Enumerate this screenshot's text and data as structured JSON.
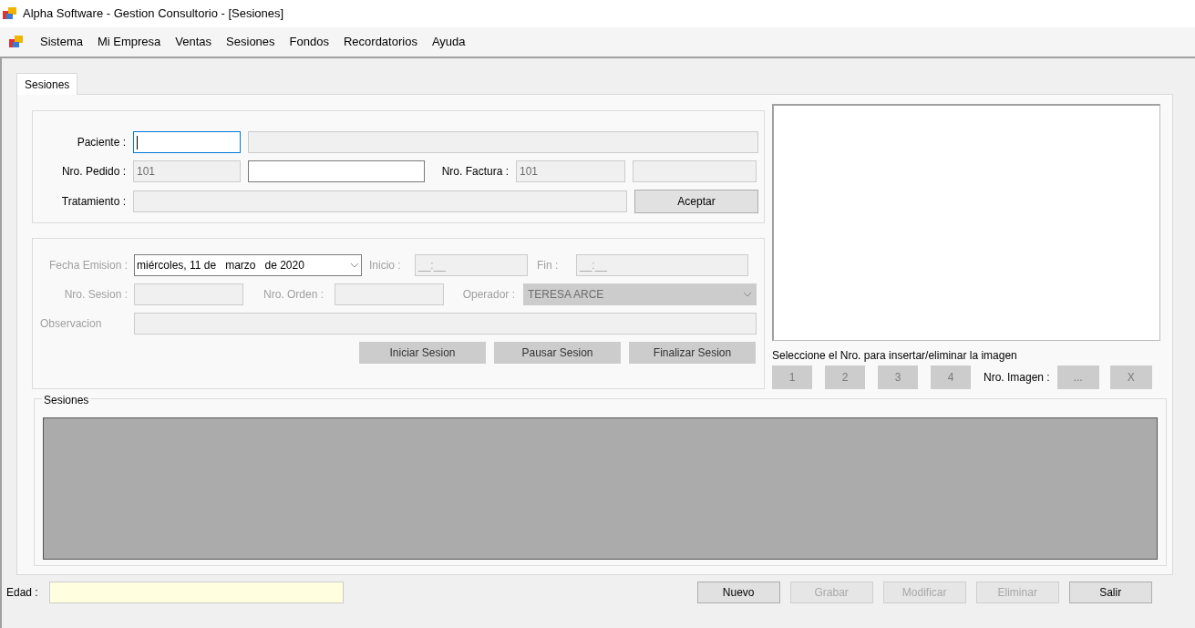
{
  "window": {
    "title": "Alpha Software - Gestion Consultorio - [Sesiones]"
  },
  "menu": [
    "Sistema",
    "Mi Empresa",
    "Ventas",
    "Sesiones",
    "Fondos",
    "Recordatorios",
    "Ayuda"
  ],
  "tabs": [
    {
      "label": "Sesiones",
      "selected": true
    }
  ],
  "patient": {
    "paciente_label": "Paciente :",
    "paciente_code": {
      "enabled": true,
      "focused": true
    },
    "paciente_name": {
      "enabled": false,
      "focused": false
    },
    "pedido_label": "Nro. Pedido :",
    "pedido": {
      "value": "101",
      "enabled": false,
      "focused": false
    },
    "pedido_extra": {
      "enabled": true,
      "focused": false
    },
    "factura_label": "Nro. Factura :",
    "factura": {
      "value": "101",
      "enabled": false,
      "focused": false
    },
    "factura_extra": {
      "enabled": false,
      "focused": false
    },
    "tratamiento_label": "Tratamiento :",
    "tratamiento": {
      "enabled": false,
      "focused": false
    },
    "accept_button": {
      "label": "Aceptar",
      "enabled": true,
      "kind": "raised"
    }
  },
  "session": {
    "enabled": false,
    "fecha_label": "Fecha Emision :",
    "fecha": {
      "value": "miércoles, 11 de   marzo   de 2020",
      "enabled": true
    },
    "inicio_label": "Inicio :",
    "inicio": {
      "value": "__:__",
      "enabled": false,
      "focused": false
    },
    "fin_label": "Fin :",
    "fin": {
      "value": "__:__",
      "enabled": false,
      "focused": false
    },
    "sesion_label": "Nro. Sesion :",
    "sesion": {
      "enabled": false,
      "focused": false
    },
    "orden_label": "Nro. Orden :",
    "orden": {
      "enabled": false,
      "focused": false
    },
    "operador_label": "Operador :",
    "operador": {
      "value": "TERESA ARCE",
      "enabled": false
    },
    "observacion_label": "Observacion",
    "observacion": {
      "enabled": false,
      "focused": false
    },
    "buttons": [
      {
        "label": "Iniciar Sesion",
        "enabled": true,
        "kind": "flat"
      },
      {
        "label": "Pausar Sesion",
        "enabled": true,
        "kind": "flat"
      },
      {
        "label": "Finalizar Sesion",
        "enabled": true,
        "kind": "flat"
      }
    ]
  },
  "image_panel": {
    "hint": "Seleccione el Nro. para insertar/eliminar la imagen",
    "number_buttons": [
      {
        "label": "1",
        "enabled": false,
        "kind": "flat"
      },
      {
        "label": "2",
        "enabled": false,
        "kind": "flat"
      },
      {
        "label": "3",
        "enabled": false,
        "kind": "flat"
      },
      {
        "label": "4",
        "enabled": false,
        "kind": "flat"
      }
    ],
    "nro_label": "Nro. Imagen :",
    "browse_button": {
      "label": "...",
      "enabled": false,
      "kind": "flat"
    },
    "clear_button": {
      "label": "X",
      "enabled": false,
      "kind": "flat"
    }
  },
  "sessions_group": {
    "title": "Sesiones"
  },
  "footer": {
    "edad_label": "Edad :",
    "buttons": [
      {
        "label": "Nuevo",
        "enabled": true,
        "kind": "raised"
      },
      {
        "label": "Grabar",
        "enabled": false,
        "kind": "raised"
      },
      {
        "label": "Modificar",
        "enabled": false,
        "kind": "raised"
      },
      {
        "label": "Eliminar",
        "enabled": false,
        "kind": "raised"
      },
      {
        "label": "Salir",
        "enabled": true,
        "kind": "raised"
      }
    ]
  }
}
